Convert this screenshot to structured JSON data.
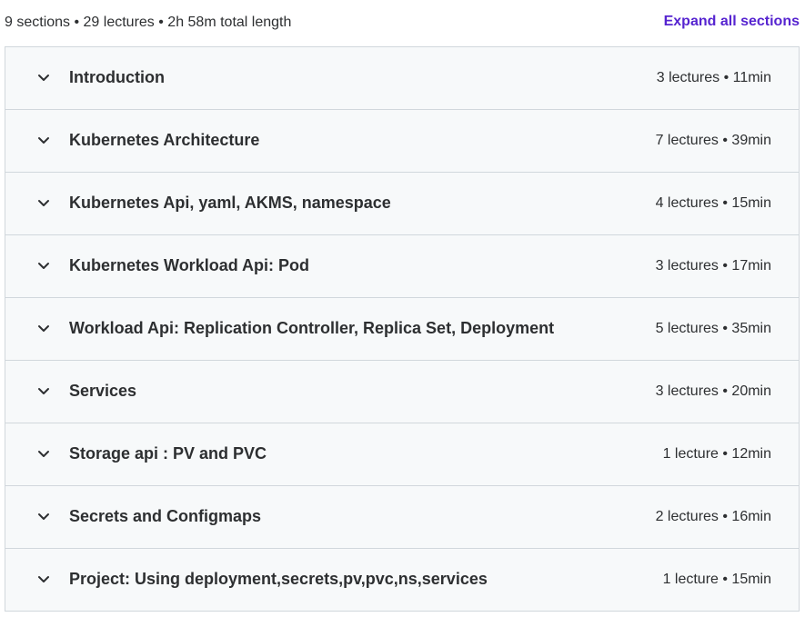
{
  "summary": {
    "text": "9 sections • 29 lectures • 2h 58m total length",
    "expand_all_label": "Expand all sections"
  },
  "colors": {
    "accent": "#5624d0",
    "section_bg": "#f7f9fa",
    "border": "#d1d7dc",
    "text": "#2d2f31"
  },
  "sections": [
    {
      "title": "Introduction",
      "meta": "3 lectures • 11min",
      "icon": "chevron-down-icon"
    },
    {
      "title": "Kubernetes Architecture",
      "meta": "7 lectures • 39min",
      "icon": "chevron-down-icon"
    },
    {
      "title": "Kubernetes Api, yaml, AKMS, namespace",
      "meta": "4 lectures • 15min",
      "icon": "chevron-down-icon"
    },
    {
      "title": "Kubernetes Workload Api: Pod",
      "meta": "3 lectures • 17min",
      "icon": "chevron-down-icon"
    },
    {
      "title": "Workload Api: Replication Controller, Replica Set, Deployment",
      "meta": "5 lectures • 35min",
      "icon": "chevron-down-icon"
    },
    {
      "title": "Services",
      "meta": "3 lectures • 20min",
      "icon": "chevron-down-icon"
    },
    {
      "title": "Storage api : PV and PVC",
      "meta": "1 lecture • 12min",
      "icon": "chevron-down-icon"
    },
    {
      "title": "Secrets and Configmaps",
      "meta": "2 lectures • 16min",
      "icon": "chevron-down-icon"
    },
    {
      "title": "Project: Using deployment,secrets,pv,pvc,ns,services",
      "meta": "1 lecture • 15min",
      "icon": "chevron-down-icon"
    }
  ]
}
